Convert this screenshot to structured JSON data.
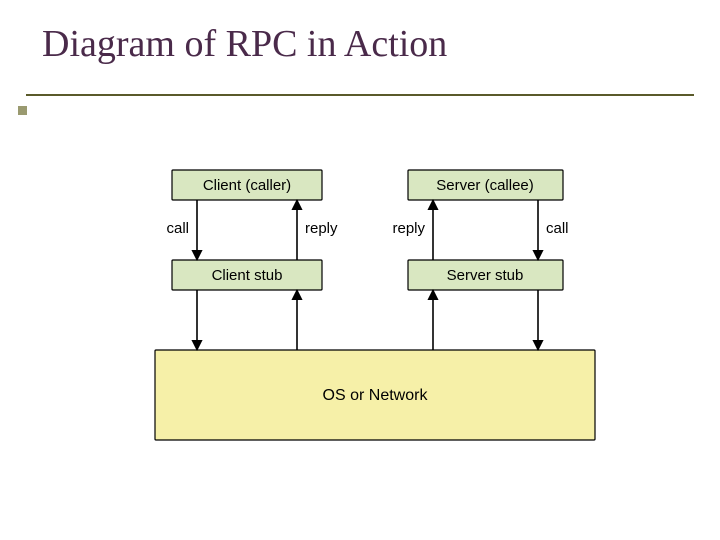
{
  "title": "Diagram of RPC in Action",
  "boxes": {
    "client_caller": "Client (caller)",
    "server_callee": "Server (callee)",
    "client_stub": "Client stub",
    "server_stub": "Server stub",
    "os_or_network": "OS or Network"
  },
  "edges": {
    "call_left": "call",
    "reply_left": "reply",
    "reply_right": "reply",
    "call_right": "call"
  },
  "colors": {
    "box_fill": "#d9e7c1",
    "os_fill": "#f6f0a8",
    "stroke": "#000000",
    "title": "#4a2a4a",
    "rule": "#5a5a2a"
  },
  "chart_data": {
    "type": "diagram",
    "title": "Diagram of RPC in Action",
    "nodes": [
      {
        "id": "client_caller",
        "label": "Client (caller)",
        "row": 0,
        "col": 0
      },
      {
        "id": "server_callee",
        "label": "Server (callee)",
        "row": 0,
        "col": 1
      },
      {
        "id": "client_stub",
        "label": "Client stub",
        "row": 1,
        "col": 0
      },
      {
        "id": "server_stub",
        "label": "Server stub",
        "row": 1,
        "col": 1
      },
      {
        "id": "os_or_network",
        "label": "OS or Network",
        "row": 2,
        "col": "span"
      }
    ],
    "edges": [
      {
        "from": "client_caller",
        "to": "client_stub",
        "label": "call",
        "dir": "down"
      },
      {
        "from": "client_stub",
        "to": "client_caller",
        "label": "reply",
        "dir": "up"
      },
      {
        "from": "server_stub",
        "to": "server_callee",
        "label": "reply",
        "dir": "up"
      },
      {
        "from": "server_callee",
        "to": "server_stub",
        "label": "call",
        "dir": "down"
      },
      {
        "from": "client_stub",
        "to": "os_or_network",
        "label": "",
        "dir": "down"
      },
      {
        "from": "os_or_network",
        "to": "client_stub",
        "label": "",
        "dir": "up"
      },
      {
        "from": "os_or_network",
        "to": "server_stub",
        "label": "",
        "dir": "up"
      },
      {
        "from": "server_stub",
        "to": "os_or_network",
        "label": "",
        "dir": "down"
      }
    ]
  }
}
